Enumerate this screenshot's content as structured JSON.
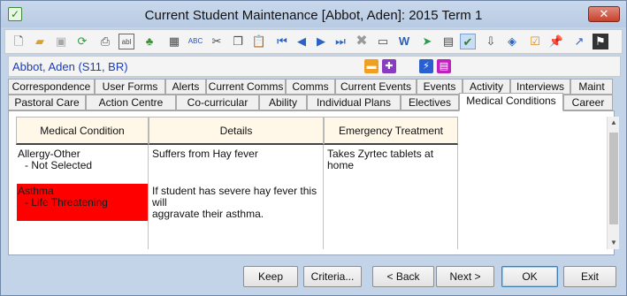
{
  "window": {
    "title": "Current Student Maintenance  [Abbot, Aden]:  2015 Term 1",
    "app_icon": "check",
    "close_label": "✕"
  },
  "toolbar": {
    "icons": [
      "new-icon",
      "open-folder-icon",
      "save-icon",
      "refresh-icon",
      "print-icon",
      "abl-icon",
      "tree-icon",
      "calculator-icon",
      "spellcheck-icon",
      "cut-icon",
      "copy-icon",
      "paste-icon",
      "first-record-icon",
      "previous-record-icon",
      "next-record-icon",
      "last-record-icon",
      "delete-icon",
      "card-icon",
      "word-icon",
      "arrow-import-icon",
      "clipboard-icon",
      "approve-icon",
      "download-tray-icon",
      "tag-icon",
      "checklist-icon",
      "pin-icon",
      "arrow-up-right-icon",
      "flag-icon"
    ]
  },
  "student": {
    "label": "Abbot, Aden (S11, BR)"
  },
  "tabs_row1": [
    "Correspondence",
    "User Forms",
    "Alerts",
    "Current Comms",
    "Comms",
    "Current Events",
    "Events",
    "Activity",
    "Interviews",
    "Maint"
  ],
  "tabs_row2": [
    "Pastoral Care",
    "Action Centre",
    "Co-curricular",
    "Ability",
    "Individual Plans",
    "Electives",
    "Medical Conditions",
    "Career"
  ],
  "selected_tab": "Medical Conditions",
  "grid": {
    "columns": [
      "Medical Condition",
      "Details",
      "Emergency Treatment"
    ],
    "rows": [
      {
        "condition": "Allergy-Other",
        "severity": "- Not Selected",
        "details": "Suffers from Hay fever",
        "treatment": "Takes Zyrtec tablets at home",
        "highlight": false
      },
      {
        "condition": "Asthma",
        "severity": "- Life Threatening",
        "details_line1": "If student has severe hay fever this will",
        "details_line2": "aggravate their asthma.",
        "treatment": "",
        "highlight": true,
        "highlight_color": "#ff0000"
      }
    ]
  },
  "buttons": {
    "keep": "Keep",
    "criteria": "Criteria...",
    "back": "< Back",
    "next": "Next >",
    "ok": "OK",
    "exit": "Exit"
  }
}
